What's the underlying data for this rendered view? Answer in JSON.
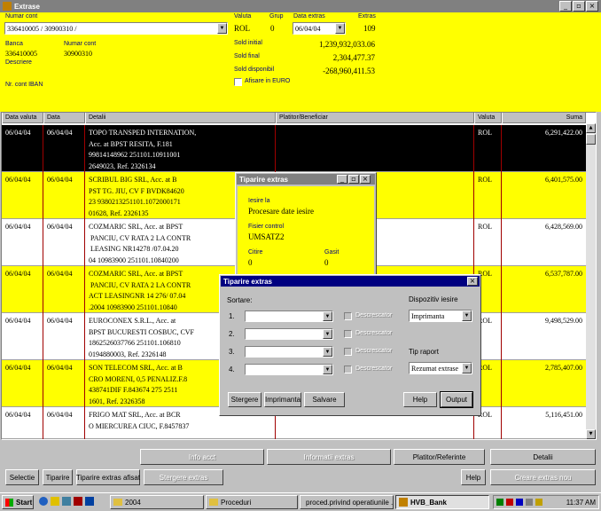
{
  "window": {
    "title": "Extrase"
  },
  "header": {
    "num_cont_label": "Numar cont",
    "num_cont_value": "336410005 / 30900310 /",
    "banca_label": "Banca",
    "banca_value": "336410005",
    "numar_cont2_label": "Numar cont",
    "numar_cont2_value": "30900310",
    "descriere_label": "Descriere",
    "iban_label": "Nr. cont IBAN",
    "valuta_label": "Valuta",
    "valuta_value": "ROL",
    "grup_label": "Grup",
    "grup_value": "0",
    "data_extras_label": "Data extras",
    "data_extras_value": "06/04/04",
    "extras_label": "Extras",
    "extras_value": "109",
    "sold_initial_label": "Sold initial",
    "sold_initial_value": "1,239,932,033.06",
    "sold_final_label": "Sold final",
    "sold_final_value": "2,304,477.37",
    "sold_disponibil_label": "Sold disponibil",
    "sold_disponibil_value": "-268,960,411.53",
    "afisare_euro_label": "Afisare in EURO"
  },
  "grid": {
    "columns": [
      "Data valuta",
      "Data",
      "Detalii",
      "Platitor/Beneficiar",
      "Valuta",
      "Suma"
    ],
    "rows": [
      {
        "dv": "06/04/04",
        "d": "06/04/04",
        "lines": [
          "TOPO TRANSPED INTERNATION,",
          "Acc. at BPST RESITA, F.181",
          "99814148962 251101.10911001",
          "2649023, Ref. 2326134"
        ],
        "val": "ROL",
        "suma": "6,291,422.00"
      },
      {
        "dv": "06/04/04",
        "d": "06/04/04",
        "lines": [
          "SCRIBUL BIG SRL, Acc. at B",
          "PST TG. JIU, CV F BVDK84620",
          "23 9380213251101.1072000171",
          "01628, Ref. 2326135"
        ],
        "val": "ROL",
        "suma": "6,401,575.00"
      },
      {
        "dv": "06/04/04",
        "d": "06/04/04",
        "lines": [
          "COZMARIC SRL, Acc. at BPST",
          " PANCIU, CV RATA 2 LA CONTR",
          " LEASING NR14278 /07.04.20",
          "04 10983900 251101.10840200"
        ],
        "val": "ROL",
        "suma": "6,428,569.00"
      },
      {
        "dv": "06/04/04",
        "d": "06/04/04",
        "lines": [
          "COZMARIC SRL, Acc. at BPST",
          " PANCIU, CV RATA 2 LA CONTR",
          "ACT LEASINGNR 14 276/ 07.04",
          ".2004 10983900 251101.10840"
        ],
        "val": "ROL",
        "suma": "6,537,787.00"
      },
      {
        "dv": "06/04/04",
        "d": "06/04/04",
        "lines": [
          "EUROCONEX S.R.L., Acc. at",
          "BPST BUCURESTI COSBUC, CVF",
          "1862526037766 251101.106810",
          "0194880003, Ref. 2326148"
        ],
        "val": "ROL",
        "suma": "9,498,529.00"
      },
      {
        "dv": "06/04/04",
        "d": "06/04/04",
        "lines": [
          "SON TELECOM SRL, Acc. at B",
          "CRO MORENI, 0,5 PENALIZ.F.8",
          "438741DIF F.843674 275 2511",
          "1601, Ref. 2326358"
        ],
        "val": "ROL",
        "suma": "2,785,407.00"
      },
      {
        "dv": "06/04/04",
        "d": "06/04/04",
        "lines": [
          "FRIGO MAT SRL, Acc. at BCR",
          "O MIERCUREA CIUC, F.8457837"
        ],
        "val": "ROL",
        "suma": "5,116,451.00"
      }
    ]
  },
  "dialog1": {
    "title": "Tiparire extras",
    "iesire_label": "Iesire la",
    "iesire_value": "Procesare date iesire",
    "fisier_label": "Fisier control",
    "fisier_value": "UMSATZ2",
    "citire_label": "Citire",
    "citire_value": "0",
    "gasit_label": "Gasit",
    "gasit_value": "0"
  },
  "dialog2": {
    "title": "Tiparire extras",
    "sortare_label": "Sortare:",
    "sort_rows": [
      "1.",
      "2.",
      "3.",
      "4."
    ],
    "descrescator_label": "Descrescator",
    "dispozitiv_label": "Dispozitiv iesire",
    "dispozitiv_value": "Imprimanta",
    "tip_raport_label": "Tip raport",
    "tip_raport_value": "Rezumat extrase",
    "btn_stergere": "Stergere",
    "btn_imprimanta": "Imprimanta",
    "btn_salvare": "Salvare",
    "btn_help": "Help",
    "btn_output": "Output"
  },
  "buttons": {
    "info_acct": "Info acct",
    "informatii_extras": "Informatii extras",
    "platitor": "Platitor/Referinte",
    "detalii": "Detalii",
    "selectie": "Selectie",
    "tiparire": "Tiparire",
    "tiparire_afisat": "Tiparire extras afisat",
    "stergere_extras": "Stergere extras",
    "help": "Help",
    "creare_extras": "Creare extras nou"
  },
  "taskbar": {
    "start": "Start",
    "items": [
      "2004",
      "Proceduri",
      "proced.privind operatiunile ...",
      "HVB_Bank"
    ],
    "clock": "11:37 AM"
  },
  "colors": {
    "yellow": "#ffff00",
    "titlebar": "#808080",
    "dialog_title": "#000080",
    "selected_row": "#000000"
  }
}
